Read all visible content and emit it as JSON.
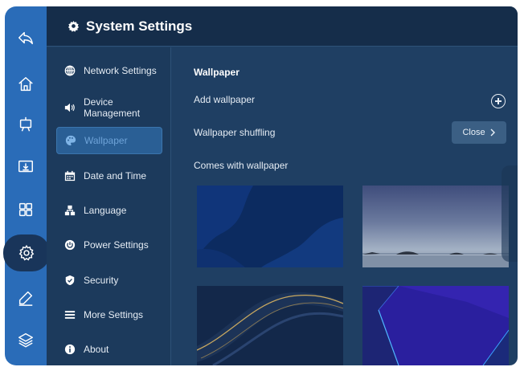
{
  "window": {
    "title": "System Settings",
    "title_icon": "gear-icon"
  },
  "dock": {
    "items": [
      {
        "name": "back",
        "icon": "back-icon"
      },
      {
        "name": "home",
        "icon": "home-icon"
      },
      {
        "name": "whiteboard",
        "icon": "easel-icon"
      },
      {
        "name": "screen-share",
        "icon": "download-screen-icon"
      },
      {
        "name": "apps",
        "icon": "grid-icon"
      },
      {
        "name": "settings",
        "icon": "gear-icon",
        "active": true
      },
      {
        "name": "annotate",
        "icon": "pen-icon"
      },
      {
        "name": "layers",
        "icon": "layers-icon"
      }
    ]
  },
  "nav": {
    "items": [
      {
        "label": "Network Settings",
        "icon": "globe-icon"
      },
      {
        "label": "Device Management",
        "icon": "speaker-icon"
      },
      {
        "label": "Wallpaper",
        "icon": "palette-icon",
        "active": true
      },
      {
        "label": "Date and Time",
        "icon": "calendar-icon"
      },
      {
        "label": "Language",
        "icon": "language-icon"
      },
      {
        "label": "Power Settings",
        "icon": "power-icon"
      },
      {
        "label": "Security",
        "icon": "shield-icon"
      },
      {
        "label": "More Settings",
        "icon": "menu-icon"
      },
      {
        "label": "About",
        "icon": "info-icon"
      }
    ]
  },
  "wallpaper": {
    "section_title": "Wallpaper",
    "add_label": "Add wallpaper",
    "shuffle_label": "Wallpaper shuffling",
    "shuffle_value": "Close",
    "builtin_label": "Comes with wallpaper",
    "thumbnails": [
      {
        "name": "dark-blue-abstract"
      },
      {
        "name": "lake-dusk"
      },
      {
        "name": "gold-waves"
      },
      {
        "name": "violet-geometric"
      }
    ]
  },
  "colors": {
    "dock": "#2a6cb8",
    "window": "#1f3f63",
    "title_bar": "#152d4a",
    "active_nav": "#2a5f95"
  }
}
